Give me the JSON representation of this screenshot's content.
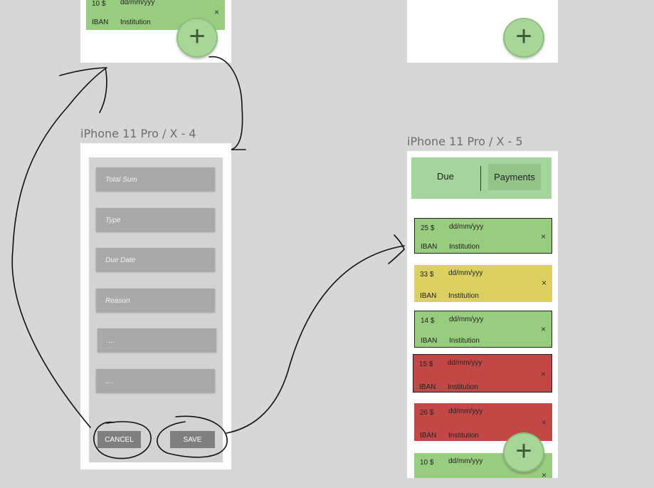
{
  "screens": {
    "top_left": {
      "card": {
        "amount": "10 $",
        "date": "dd/mm/yyy",
        "iban": "IBAN",
        "institution": "Institution",
        "close": "×"
      },
      "fab_icon": "+"
    },
    "top_right": {
      "fab_icon": "+"
    },
    "form": {
      "title": "iPhone 11 Pro / X - 4",
      "fields": [
        {
          "placeholder": "Total Sum"
        },
        {
          "placeholder": "Type"
        },
        {
          "placeholder": "Due Date"
        },
        {
          "placeholder": "Reason"
        },
        {
          "placeholder": "...."
        },
        {
          "placeholder": "...."
        }
      ],
      "cancel_label": "CANCEL",
      "save_label": "SAVE"
    },
    "list": {
      "title": "iPhone 11 Pro / X - 5",
      "tabs": {
        "due": "Due",
        "payments": "Payments"
      },
      "cards": [
        {
          "amount": "25 $",
          "date": "dd/mm/yyy",
          "iban": "IBAN",
          "institution": "Institution",
          "close": "×",
          "color": "green"
        },
        {
          "amount": "33 $",
          "date": "dd/mm/yyy",
          "iban": "IBAN",
          "institution": "Institution",
          "close": "×",
          "color": "yellow"
        },
        {
          "amount": "14 $",
          "date": "dd/mm/yyy",
          "iban": "IBAN",
          "institution": "Institution",
          "close": "×",
          "color": "green"
        },
        {
          "amount": "15 $",
          "date": "dd/mm/yyy",
          "iban": "IBAN",
          "institution": "Institution",
          "close": "×",
          "color": "red"
        },
        {
          "amount": "26 $",
          "date": "dd/mm/yyy",
          "iban": "IBAN",
          "institution": "Institution",
          "close": "×",
          "color": "red"
        },
        {
          "amount": "10 $",
          "date": "dd/mm/yyy",
          "close": "×",
          "color": "green"
        }
      ],
      "fab_icon": "+"
    }
  },
  "colors": {
    "green": "#98cc7e",
    "yellow": "#dcd062",
    "red": "#c24848",
    "header_green": "#a4d59c"
  }
}
